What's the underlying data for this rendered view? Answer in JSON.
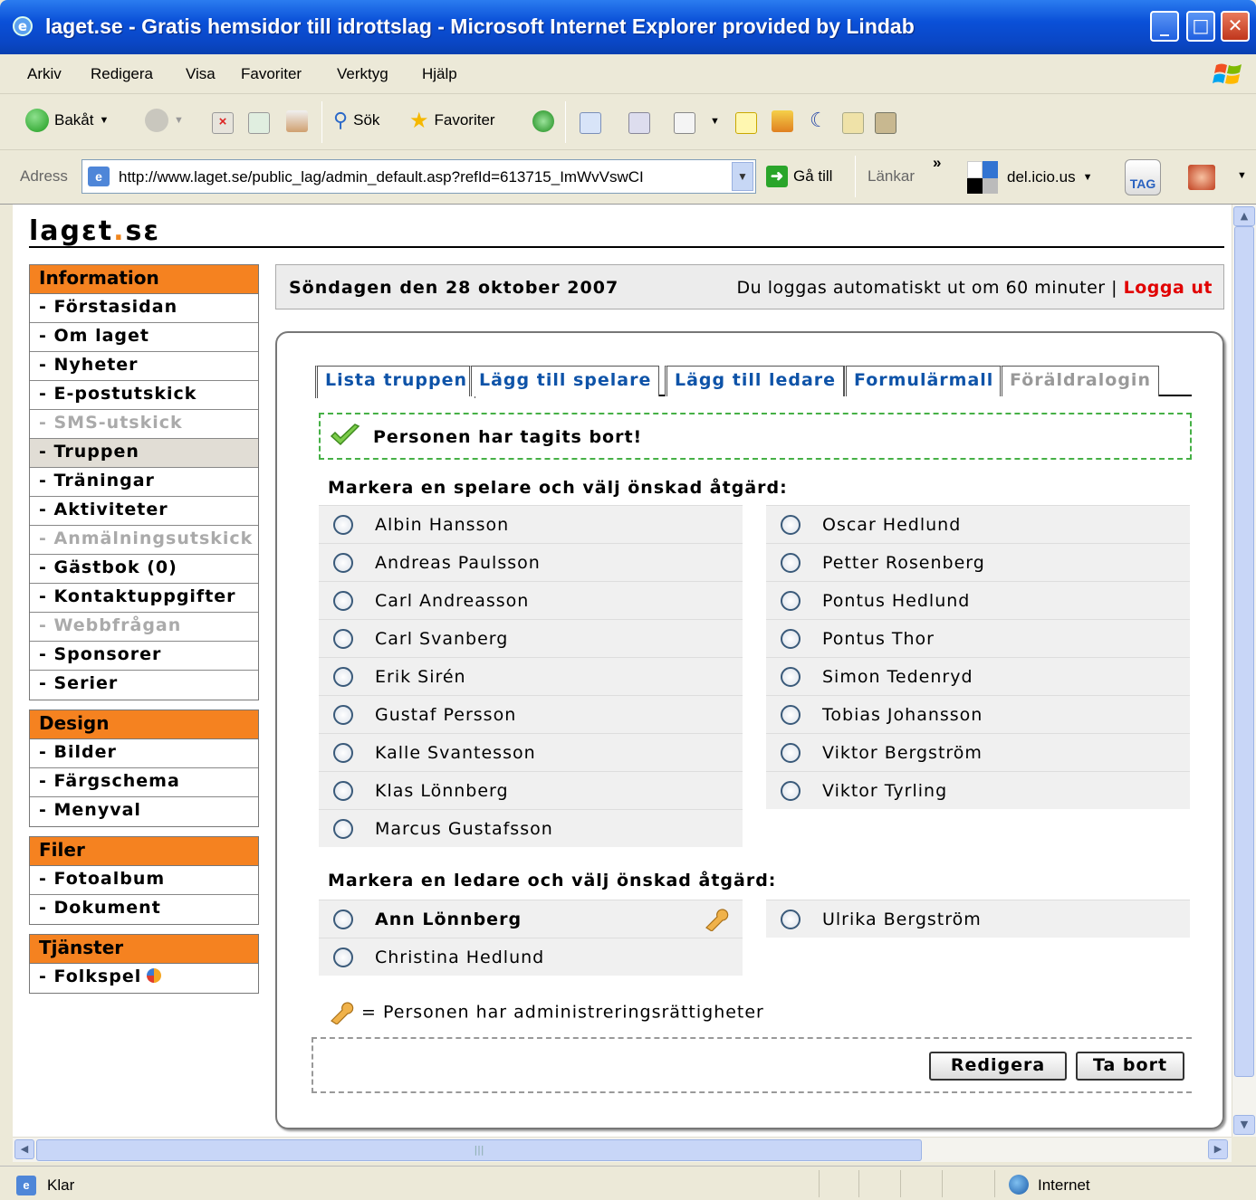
{
  "window": {
    "title": "laget.se - Gratis hemsidor till idrottslag - Microsoft Internet Explorer provided by Lindab"
  },
  "menu": [
    "Arkiv",
    "Redigera",
    "Visa",
    "Favoriter",
    "Verktyg",
    "Hjälp"
  ],
  "toolbar": {
    "back_label": "Bakåt",
    "search_label": "Sök",
    "favorites_label": "Favoriter"
  },
  "address": {
    "label": "Adress",
    "url": "http://www.laget.se/public_lag/admin_default.asp?refId=613715_ImWvVswCI",
    "go_label": "Gå till",
    "links_label": "Länkar",
    "delicious_label": "del.icio.us",
    "tag_label": "TAG"
  },
  "site": {
    "logo_main": "lag",
    "logo_e": "ε",
    "logo_t": "t",
    "logo_dot": ".",
    "logo_se": "sε"
  },
  "sidebar": {
    "groups": [
      {
        "title": "Information",
        "items": [
          {
            "label": "- Förstasidan",
            "state": "normal"
          },
          {
            "label": "- Om laget",
            "state": "normal"
          },
          {
            "label": "- Nyheter",
            "state": "normal"
          },
          {
            "label": "- E-postutskick",
            "state": "normal"
          },
          {
            "label": "- SMS-utskick",
            "state": "disabled"
          },
          {
            "label": "- Truppen",
            "state": "active"
          },
          {
            "label": "- Träningar",
            "state": "normal"
          },
          {
            "label": "- Aktiviteter",
            "state": "normal"
          },
          {
            "label": "- Anmälningsutskick",
            "state": "disabled"
          },
          {
            "label": "- Gästbok (0)",
            "state": "normal"
          },
          {
            "label": "- Kontaktuppgifter",
            "state": "normal"
          },
          {
            "label": "- Webbfrågan",
            "state": "disabled"
          },
          {
            "label": "- Sponsorer",
            "state": "normal"
          },
          {
            "label": "- Serier",
            "state": "normal"
          }
        ]
      },
      {
        "title": "Design",
        "items": [
          {
            "label": "- Bilder",
            "state": "normal"
          },
          {
            "label": "- Färgschema",
            "state": "normal"
          },
          {
            "label": "- Menyval",
            "state": "normal"
          }
        ]
      },
      {
        "title": "Filer",
        "items": [
          {
            "label": "- Fotoalbum",
            "state": "normal"
          },
          {
            "label": "- Dokument",
            "state": "normal"
          }
        ]
      },
      {
        "title": "Tjänster",
        "items": [
          {
            "label": "- Folkspel",
            "state": "normal"
          }
        ]
      }
    ]
  },
  "header": {
    "date": "Söndagen den 28 oktober 2007",
    "autologout": "Du loggas automatiskt ut om 60 minuter |",
    "logout_label": "Logga ut"
  },
  "tabs": [
    {
      "label": "Lista truppen",
      "state": "active"
    },
    {
      "label": "Lägg till spelare",
      "state": "normal"
    },
    {
      "label": "Lägg till ledare",
      "state": "normal"
    },
    {
      "label": "Formulärmall",
      "state": "normal"
    },
    {
      "label": "Föräldralogin",
      "state": "disabled"
    }
  ],
  "message": "Personen har tagits bort!",
  "players": {
    "heading": "Markera en spelare och välj önskad åtgärd:",
    "left": [
      "Albin Hansson",
      "Andreas Paulsson",
      "Carl Andreasson",
      "Carl Svanberg",
      "Erik Sirén",
      "Gustaf Persson",
      "Kalle Svantesson",
      "Klas Lönnberg",
      "Marcus Gustafsson"
    ],
    "right": [
      "Oscar Hedlund",
      "Petter Rosenberg",
      "Pontus Hedlund",
      "Pontus Thor",
      "Simon Tedenryd",
      "Tobias Johansson",
      "Viktor Bergström",
      "Viktor Tyrling"
    ]
  },
  "leaders": {
    "heading": "Markera en ledare och välj önskad åtgärd:",
    "left": [
      {
        "name": "Ann Lönnberg",
        "admin": true
      },
      {
        "name": "Christina Hedlund",
        "admin": false
      }
    ],
    "right": [
      {
        "name": "Ulrika Bergström",
        "admin": false
      }
    ]
  },
  "legend": "= Personen har administreringsrättigheter",
  "buttons": {
    "edit": "Redigera",
    "delete": "Ta bort"
  },
  "status": {
    "text": "Klar",
    "zone": "Internet"
  },
  "colors": {
    "accent": "#f58220",
    "tab_text": "#0e53a8",
    "logout": "#e10000",
    "success_border": "#46b046"
  }
}
